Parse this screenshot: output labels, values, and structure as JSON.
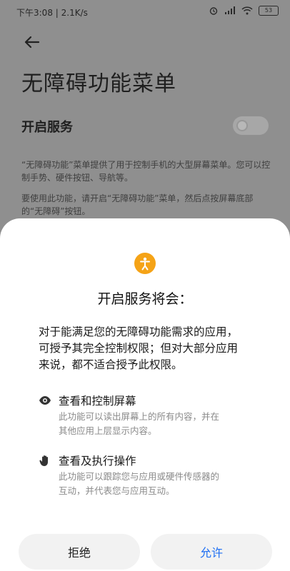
{
  "status_bar": {
    "time_speed": "下午3:08 | 2.1K/s",
    "battery": "53"
  },
  "page": {
    "title": "无障碍功能菜单",
    "setting_label": "开启服务",
    "toggle_on": false,
    "desc1_line1": "“无障碍功能”菜单提供了用于控制手机的大型屏幕菜单。您可以控",
    "desc1_line2": "制手势、硬件按钮、导航等。",
    "desc2_line1": "要使用此功能，请开启“无障碍功能”菜单，然后点按屏幕底部",
    "desc2_line2": "的“无障碍”按钮。"
  },
  "dialog": {
    "icon": "accessibility-icon",
    "accent_color": "#f5a316",
    "title": "开启服务将会：",
    "intro_line1": "对于能满足您的无障碍功能需求的应用，",
    "intro_line2": "可授予其完全控制权限；但对大部分应用",
    "intro_line3": "来说，都不适合授予此权限。",
    "permissions": [
      {
        "icon": "eye-icon",
        "title": "查看和控制屏幕",
        "desc_line1": "此功能可以读出屏幕上的所有内容，并在",
        "desc_line2": "其他应用上层显示内容。"
      },
      {
        "icon": "hand-icon",
        "title": "查看及执行操作",
        "desc_line1": "此功能可以跟踪您与应用或硬件传感器的",
        "desc_line2": "互动，并代表您与应用互动。"
      }
    ],
    "deny_label": "拒绝",
    "allow_label": "允许",
    "allow_color": "#1e6ff3"
  }
}
